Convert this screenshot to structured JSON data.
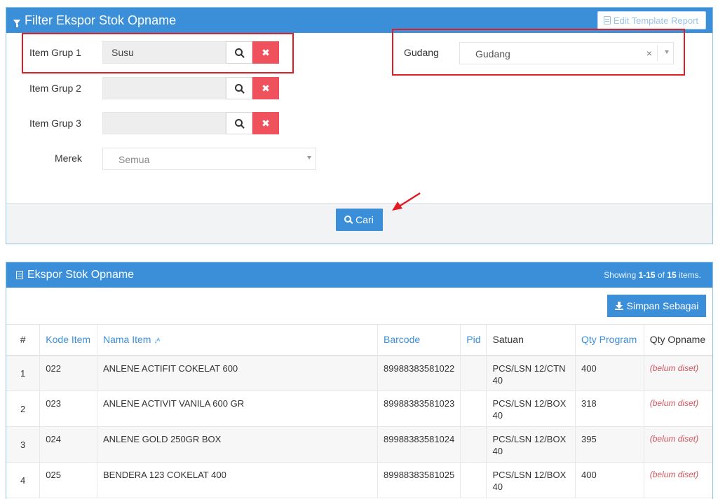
{
  "filter_panel": {
    "title": "Filter Ekspor Stok Opname",
    "edit_template_label": "Edit Template Report",
    "fields": {
      "item_grup_1": {
        "label": "Item Grup 1",
        "value": "Susu"
      },
      "item_grup_2": {
        "label": "Item Grup 2",
        "value": ""
      },
      "item_grup_3": {
        "label": "Item Grup 3",
        "value": ""
      },
      "merek": {
        "label": "Merek",
        "value": "Semua"
      },
      "gudang": {
        "label": "Gudang",
        "value": "Gudang"
      }
    },
    "clear_glyph": "✖",
    "cari_label": "Cari"
  },
  "table_panel": {
    "title": "Ekspor Stok Opname",
    "showing_prefix": "Showing ",
    "showing_range": "1-15",
    "showing_mid": " of ",
    "showing_total": "15",
    "showing_suffix": " items.",
    "simpan_label": "Simpan Sebagai",
    "columns": [
      "#",
      "Kode Item",
      "Nama Item",
      "Barcode",
      "Pid",
      "Satuan",
      "Qty Program",
      "Qty Opname"
    ],
    "rows": [
      {
        "no": "1",
        "kode": "022",
        "nama": "ANLENE ACTIFIT COKELAT 600",
        "barcode": "89988383581022",
        "pid": "",
        "satuan": "PCS/LSN 12/CTN 40",
        "qty_program": "400",
        "qty_opname": "(belum diset)"
      },
      {
        "no": "2",
        "kode": "023",
        "nama": "ANLENE ACTIVIT VANILA 600 GR",
        "barcode": "89988383581023",
        "pid": "",
        "satuan": "PCS/LSN 12/BOX 40",
        "qty_program": "318",
        "qty_opname": "(belum diset)"
      },
      {
        "no": "3",
        "kode": "024",
        "nama": "ANLENE GOLD 250GR BOX",
        "barcode": "89988383581024",
        "pid": "",
        "satuan": "PCS/LSN 12/BOX 40",
        "qty_program": "395",
        "qty_opname": "(belum diset)"
      },
      {
        "no": "4",
        "kode": "025",
        "nama": "BENDERA 123 COKELAT 400",
        "barcode": "89988383581025",
        "pid": "",
        "satuan": "PCS/LSN 12/BOX 40",
        "qty_program": "400",
        "qty_opname": "(belum diset)"
      }
    ]
  },
  "colors": {
    "accent": "#3b8fd8",
    "danger": "#f0525d",
    "highlight": "#e01d24"
  }
}
